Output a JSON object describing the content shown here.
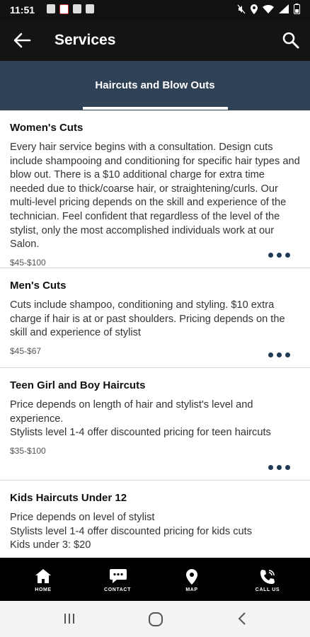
{
  "status_bar": {
    "time": "11:51"
  },
  "app_bar": {
    "title": "Services"
  },
  "tabs": [
    {
      "label": "Haircuts and Blow Outs",
      "active": true
    }
  ],
  "services": [
    {
      "name": "Women's Cuts",
      "description": "Every hair service begins with a consultation. Design cuts include shampooing and conditioning for specific hair types and blow out. There is a $10 additional charge for extra time needed due to thick/coarse hair, or straightening/curls. Our multi-level pricing depends on the skill and experience of the technician. Feel confident that regardless of the level of the stylist, only the most accomplished individuals work at our Salon.",
      "price": "$45-$100"
    },
    {
      "name": "Men's Cuts",
      "description": "Cuts include shampoo, conditioning and styling. $10 extra charge if hair is at or past shoulders. Pricing depends on the skill and experience of stylist",
      "price": "$45-$67"
    },
    {
      "name": "Teen Girl and Boy Haircuts",
      "description_lines": [
        "Price depends on length of hair and stylist's level and experience.",
        "Stylists level 1-4 offer discounted pricing for teen haircuts"
      ],
      "price": "$35-$100"
    },
    {
      "name": "Kids Haircuts Under 12",
      "description_lines": [
        "Price depends on level of stylist",
        "Stylists level 1-4 offer discounted pricing for kids cuts",
        "Kids under 3: $20"
      ]
    }
  ],
  "bottom_nav": [
    {
      "label": "HOME",
      "icon": "home-icon"
    },
    {
      "label": "CONTACT",
      "icon": "chat-icon"
    },
    {
      "label": "MAP",
      "icon": "map-pin-icon"
    },
    {
      "label": "CALL US",
      "icon": "phone-icon"
    }
  ],
  "colors": {
    "tab_bar": "#2f4256",
    "accent_dots": "#1f3a55",
    "app_bar": "#141414"
  }
}
